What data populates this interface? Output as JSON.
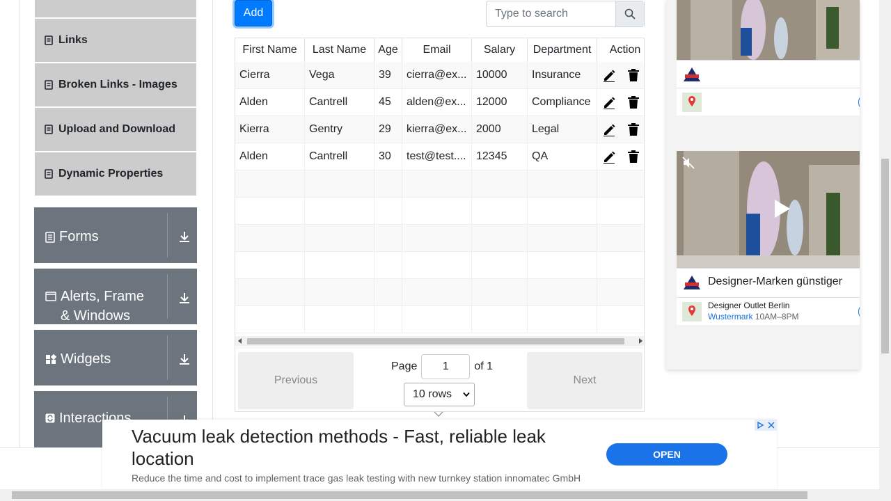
{
  "sidebar": {
    "sub_items": [
      {
        "label": "Links"
      },
      {
        "label": "Broken Links - Images"
      },
      {
        "label": "Upload and Download"
      },
      {
        "label": "Dynamic Properties"
      }
    ],
    "groups": [
      {
        "label": "Forms"
      },
      {
        "label": "Alerts, Frame & Windows"
      },
      {
        "label": "Widgets"
      },
      {
        "label": "Interactions"
      }
    ]
  },
  "toolbar": {
    "add_label": "Add",
    "search_placeholder": "Type to search"
  },
  "table": {
    "columns": [
      "First Name",
      "Last Name",
      "Age",
      "Email",
      "Salary",
      "Department",
      "Action"
    ],
    "rows": [
      {
        "first": "Cierra",
        "last": "Vega",
        "age": "39",
        "email": "cierra@ex...",
        "salary": "10000",
        "department": "Insurance"
      },
      {
        "first": "Alden",
        "last": "Cantrell",
        "age": "45",
        "email": "alden@ex...",
        "salary": "12000",
        "department": "Compliance"
      },
      {
        "first": "Kierra",
        "last": "Gentry",
        "age": "29",
        "email": "kierra@ex...",
        "salary": "2000",
        "department": "Legal"
      },
      {
        "first": "Alden",
        "last": "Cantrell",
        "age": "30",
        "email": "test@test....",
        "salary": "12345",
        "department": "QA"
      }
    ]
  },
  "pagination": {
    "previous_label": "Previous",
    "next_label": "Next",
    "page_label": "Page",
    "current_page": "1",
    "of_label": "of 1",
    "rows_option": "10 rows"
  },
  "side_ad": {
    "title": "Designer-Marken günstiger",
    "place_name": "Designer Outlet Berlin",
    "place_city": "Wustermark",
    "place_hours": "10AM–8PM"
  },
  "banner_ad": {
    "title": "Vacuum leak detection methods - Fast, reliable leak location",
    "description": "Reduce the time and cost to implement trace gas leak testing with new turnkey station innomatec GmbH",
    "cta": "OPEN"
  },
  "colors": {
    "primary": "#007bff",
    "sidebar_group": "#6c757d",
    "sidebar_item": "#cccccc",
    "ad_button": "#1a73e8"
  }
}
